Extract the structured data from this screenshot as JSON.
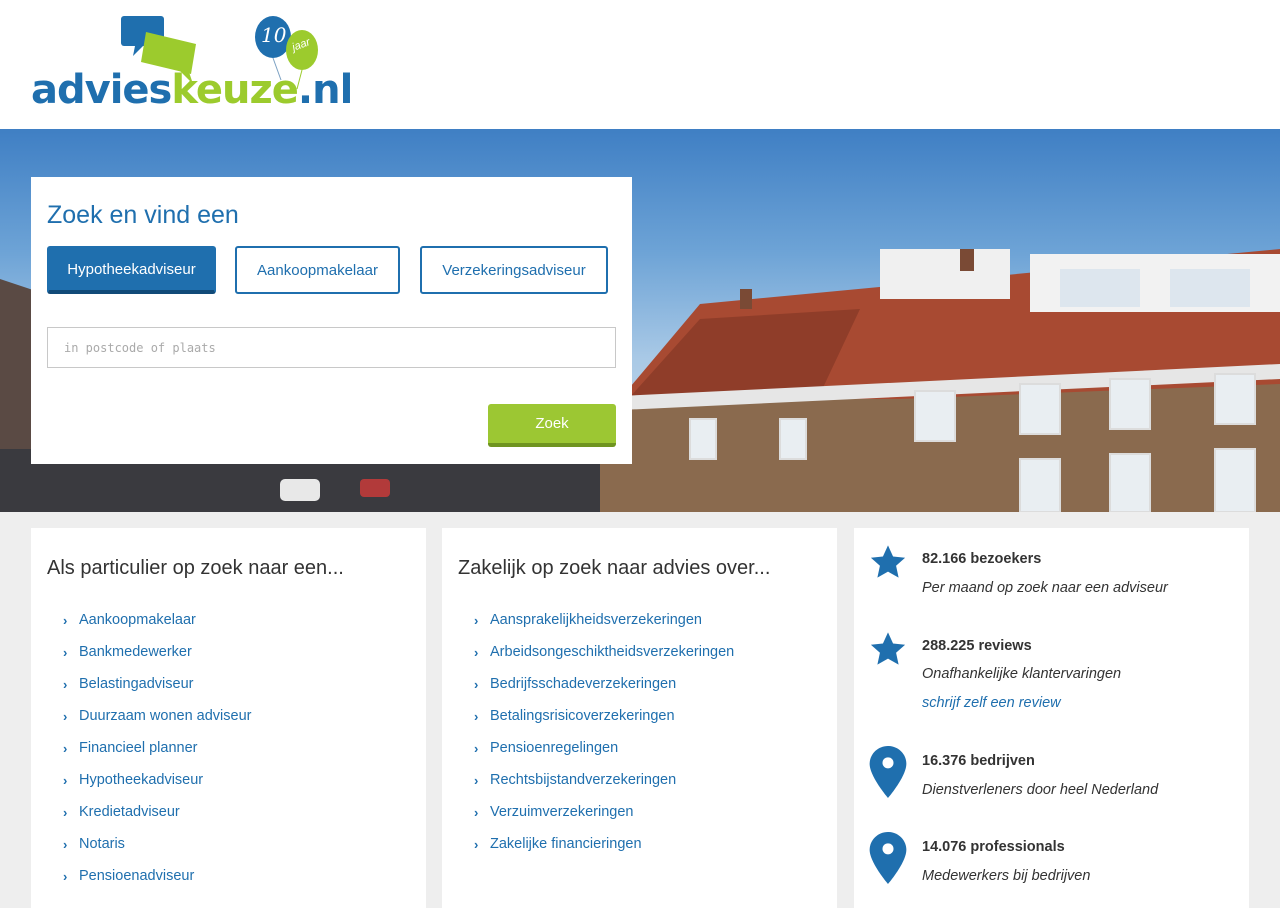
{
  "header": {
    "logo": {
      "part1": "advies",
      "part2": "keuze",
      "part3": ".nl",
      "badge_number": "10",
      "badge_text": "jaar"
    }
  },
  "search": {
    "title": "Zoek en vind een",
    "tabs": [
      {
        "label": "Hypotheekadviseur",
        "active": true
      },
      {
        "label": "Aankoopmakelaar",
        "active": false
      },
      {
        "label": "Verzekeringsadviseur",
        "active": false
      }
    ],
    "placeholder": "in postcode of plaats",
    "button_label": "Zoek"
  },
  "particulier": {
    "title": "Als particulier op zoek naar een...",
    "items": [
      "Aankoopmakelaar",
      "Bankmedewerker",
      "Belastingadviseur",
      "Duurzaam wonen adviseur",
      "Financieel planner",
      "Hypotheekadviseur",
      "Kredietadviseur",
      "Notaris",
      "Pensioenadviseur"
    ]
  },
  "zakelijk": {
    "title": "Zakelijk op zoek naar advies over...",
    "items": [
      "Aansprakelijkheidsverzekeringen",
      "Arbeidsongeschiktheidsverzekeringen",
      "Bedrijfsschadeverzekeringen",
      "Betalingsrisicoverzekeringen",
      "Pensioenregelingen",
      "Rechtsbijstandverzekeringen",
      "Verzuimverzekeringen",
      "Zakelijke financieringen"
    ]
  },
  "stats": [
    {
      "icon": "star-icon",
      "number": "82.166 bezoekers",
      "desc": "Per maand op zoek naar een adviseur"
    },
    {
      "icon": "star-icon",
      "number": "288.225 reviews",
      "desc": "Onafhankelijke klantervaringen",
      "link": "schrijf zelf een review"
    },
    {
      "icon": "map-pin-icon",
      "number": "16.376 bedrijven",
      "desc": "Dienstverleners door heel Nederland"
    },
    {
      "icon": "map-pin-icon",
      "number": "14.076 professionals",
      "desc": "Medewerkers bij bedrijven"
    }
  ],
  "colors": {
    "brand_blue": "#1f6fae",
    "brand_green": "#9cc733",
    "background": "#eeeeee"
  }
}
